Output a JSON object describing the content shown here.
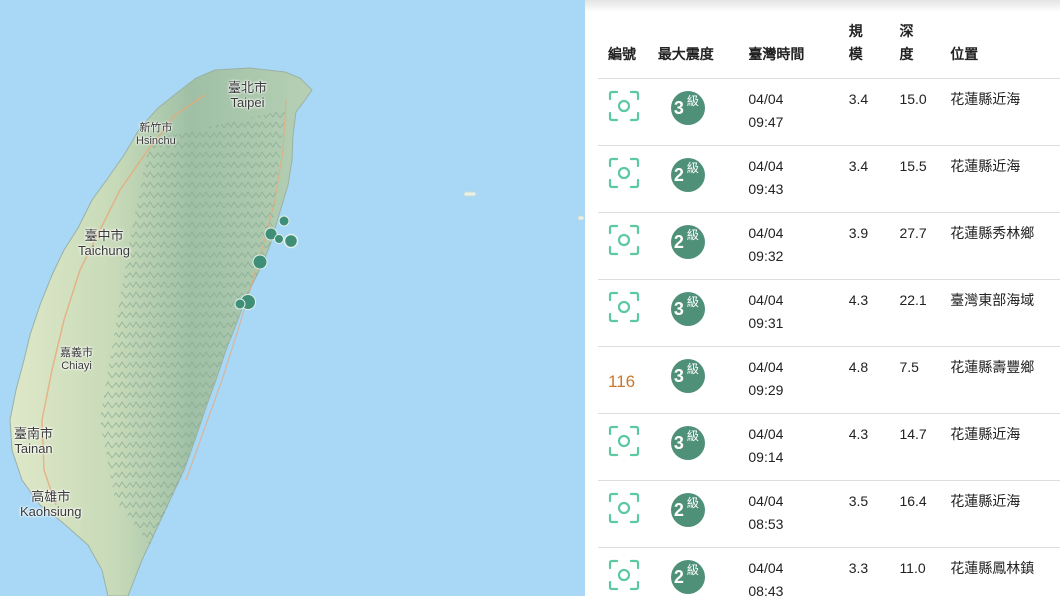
{
  "map": {
    "cities": [
      {
        "zh": "臺北市",
        "en": "Taipei"
      },
      {
        "zh": "新竹市",
        "en": "Hsinchu"
      },
      {
        "zh": "臺中市",
        "en": "Taichung"
      },
      {
        "zh": "嘉義市",
        "en": "Chiayi"
      },
      {
        "zh": "臺南市",
        "en": "Tainan"
      },
      {
        "zh": "高雄市",
        "en": "Kaohsiung"
      }
    ],
    "marker_color": "#3f8f78",
    "sea_color": "#a8d8f5",
    "land_color": "#c8dcbc"
  },
  "table": {
    "headers": {
      "id": "編號",
      "intensity": "最大震度",
      "time": "臺灣時間",
      "magnitude": "規\n模",
      "depth": "深\n度",
      "location": "位置"
    },
    "intensity_suffix": "級",
    "rows": [
      {
        "id": "",
        "intensity": "3",
        "date": "04/04",
        "clock": "09:47",
        "magnitude": "3.4",
        "depth": "15.0",
        "location": "花蓮縣近海"
      },
      {
        "id": "",
        "intensity": "2",
        "date": "04/04",
        "clock": "09:43",
        "magnitude": "3.4",
        "depth": "15.5",
        "location": "花蓮縣近海"
      },
      {
        "id": "",
        "intensity": "2",
        "date": "04/04",
        "clock": "09:32",
        "magnitude": "3.9",
        "depth": "27.7",
        "location": "花蓮縣秀林鄉"
      },
      {
        "id": "",
        "intensity": "3",
        "date": "04/04",
        "clock": "09:31",
        "magnitude": "4.3",
        "depth": "22.1",
        "location": "臺灣東部海域"
      },
      {
        "id": "116",
        "intensity": "3",
        "date": "04/04",
        "clock": "09:29",
        "magnitude": "4.8",
        "depth": "7.5",
        "location": "花蓮縣壽豐鄉"
      },
      {
        "id": "",
        "intensity": "3",
        "date": "04/04",
        "clock": "09:14",
        "magnitude": "4.3",
        "depth": "14.7",
        "location": "花蓮縣近海"
      },
      {
        "id": "",
        "intensity": "2",
        "date": "04/04",
        "clock": "08:53",
        "magnitude": "3.5",
        "depth": "16.4",
        "location": "花蓮縣近海"
      },
      {
        "id": "",
        "intensity": "2",
        "date": "04/04",
        "clock": "08:43",
        "magnitude": "3.3",
        "depth": "11.0",
        "location": "花蓮縣鳳林鎮"
      }
    ],
    "focus_icon_color": "#5cc9a0",
    "badge_color": "#4f9079",
    "id_color": "#c8782e"
  }
}
